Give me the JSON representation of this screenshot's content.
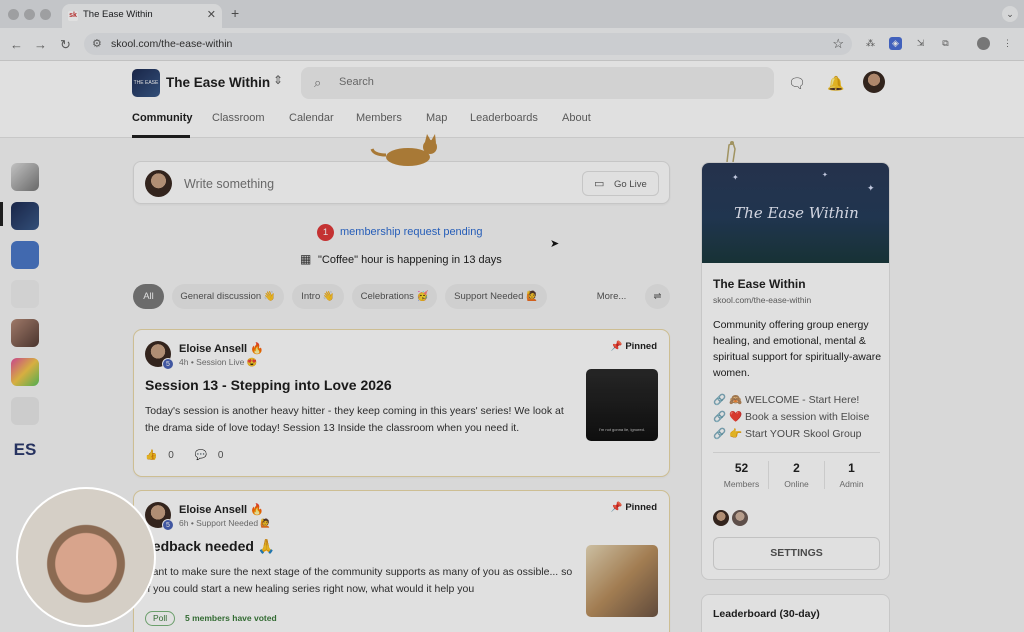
{
  "browser": {
    "tab_title": "The Ease Within",
    "tab_favicon": "sk",
    "url": "skool.com/the-ease-within"
  },
  "header": {
    "group_name": "The Ease Within",
    "search_placeholder": "Search",
    "nav": [
      "Community",
      "Classroom",
      "Calendar",
      "Members",
      "Map",
      "Leaderboards",
      "About"
    ],
    "active_nav": "Community"
  },
  "composer": {
    "placeholder": "Write something",
    "go_live": "Go Live"
  },
  "notice": {
    "pending_count": "1",
    "pending_text": "membership request pending",
    "event_text": "\"Coffee\" hour is happening in 13 days"
  },
  "filters": {
    "chips": [
      "All",
      "General discussion 👋",
      "Intro 👋",
      "Celebrations 🥳",
      "Support Needed 🙋",
      "More..."
    ]
  },
  "posts": [
    {
      "author": "Eloise Ansell 🔥",
      "level": "5",
      "meta": "4h • Session Live 😍",
      "pinned": "Pinned",
      "title": "Session 13 - Stepping into Love 2026",
      "body": "Today's session is another heavy hitter - they keep coming in this years' series! We look at the drama side of love today! Session 13 Inside the classroom when you need it.",
      "likes": "0",
      "comments": "0",
      "thumb_caption": "I'm not gonna lie, ignored."
    },
    {
      "author": "Eloise Ansell 🔥",
      "level": "5",
      "meta": "6h • Support Needed 🙋",
      "pinned": "Pinned",
      "title": "eedback needed 🙏",
      "body": "want to make sure the next stage of the community supports as many of you as ossible... so if you could start a new healing series right now, what would it help you",
      "poll_label": "Poll",
      "poll_votes": "5 members have voted"
    }
  ],
  "sidebar": {
    "cover_title": "The Ease Within",
    "name": "The Ease Within",
    "url": "skool.com/the-ease-within",
    "description": "Community offering group energy healing, and emotional, mental & spiritual support for spiritually-aware women.",
    "links": [
      "🙈 WELCOME - Start Here!",
      "❤️ Book a session with Eloise",
      "👉 Start YOUR Skool Group"
    ],
    "stats": [
      {
        "value": "52",
        "label": "Members"
      },
      {
        "value": "2",
        "label": "Online"
      },
      {
        "value": "1",
        "label": "Admin"
      }
    ],
    "settings": "SETTINGS",
    "leaderboard_title": "Leaderboard (30-day)"
  },
  "rail": {
    "es_label": "ES"
  },
  "icons": {
    "link": "🔗",
    "pin": "📌",
    "like": "👍",
    "comment": "💬"
  }
}
